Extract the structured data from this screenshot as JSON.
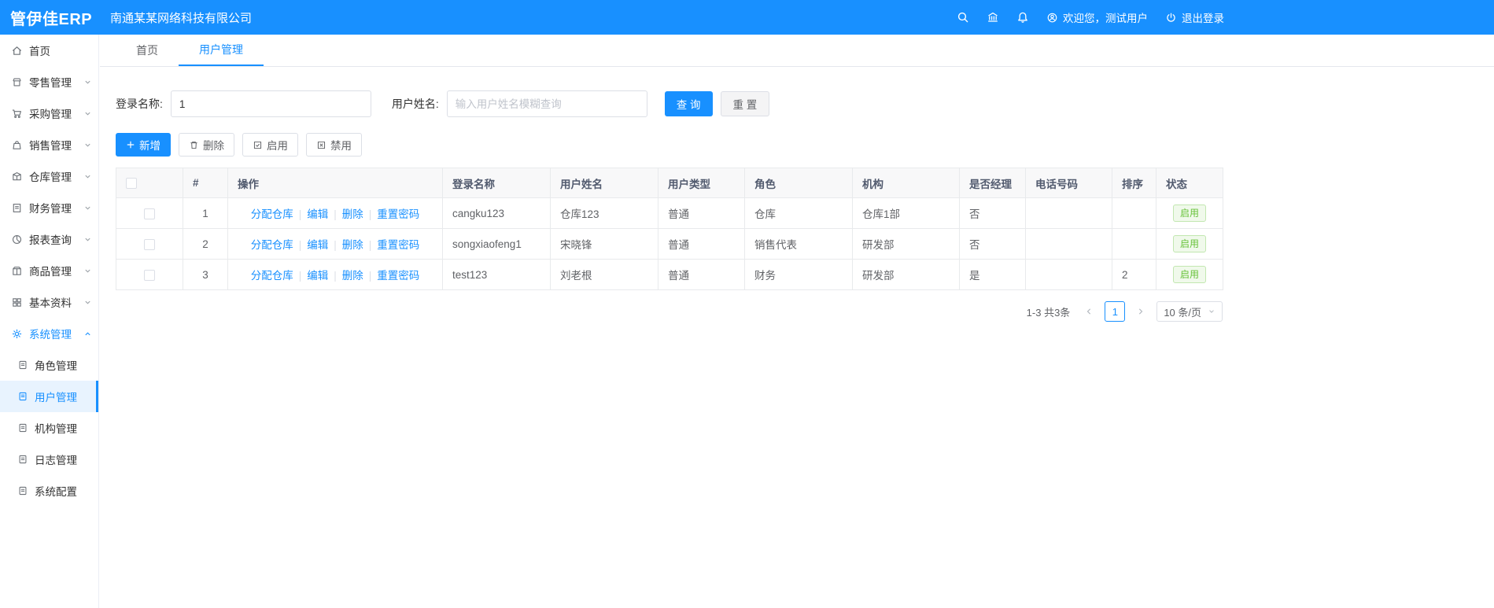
{
  "header": {
    "logo": "管伊佳ERP",
    "company": "南通某某网络科技有限公司",
    "welcome": "欢迎您，测试用户",
    "logout": "退出登录"
  },
  "sidebar": {
    "items": [
      {
        "label": "首页"
      },
      {
        "label": "零售管理"
      },
      {
        "label": "采购管理"
      },
      {
        "label": "销售管理"
      },
      {
        "label": "仓库管理"
      },
      {
        "label": "财务管理"
      },
      {
        "label": "报表查询"
      },
      {
        "label": "商品管理"
      },
      {
        "label": "基本资料"
      },
      {
        "label": "系统管理"
      }
    ],
    "subitems": [
      {
        "label": "角色管理"
      },
      {
        "label": "用户管理"
      },
      {
        "label": "机构管理"
      },
      {
        "label": "日志管理"
      },
      {
        "label": "系统配置"
      }
    ]
  },
  "tabs": [
    {
      "label": "首页"
    },
    {
      "label": "用户管理"
    }
  ],
  "filter": {
    "login_label": "登录名称:",
    "login_value": "1",
    "name_label": "用户姓名:",
    "name_placeholder": "输入用户姓名模糊查询",
    "search_label": "查 询",
    "reset_label": "重 置"
  },
  "toolbar": {
    "add_label": "新增",
    "delete_label": "删除",
    "enable_label": "启用",
    "disable_label": "禁用"
  },
  "table": {
    "headers": {
      "index": "#",
      "actions": "操作",
      "login": "登录名称",
      "name": "用户姓名",
      "type": "用户类型",
      "role": "角色",
      "org": "机构",
      "manager": "是否经理",
      "phone": "电话号码",
      "sort": "排序",
      "status": "状态"
    },
    "op_links": [
      "分配仓库",
      "编辑",
      "删除",
      "重置密码"
    ],
    "rows": [
      {
        "index": "1",
        "login": "cangku123",
        "name": "仓库123",
        "type": "普通",
        "role": "仓库",
        "org": "仓库1部",
        "manager": "否",
        "phone": "",
        "sort": "",
        "status": "启用"
      },
      {
        "index": "2",
        "login": "songxiaofeng1",
        "name": "宋晓锋",
        "type": "普通",
        "role": "销售代表",
        "org": "研发部",
        "manager": "否",
        "phone": "",
        "sort": "",
        "status": "启用"
      },
      {
        "index": "3",
        "login": "test123",
        "name": "刘老根",
        "type": "普通",
        "role": "财务",
        "org": "研发部",
        "manager": "是",
        "phone": "",
        "sort": "2",
        "status": "启用"
      }
    ]
  },
  "pagination": {
    "summary": "1-3 共3条",
    "current_page": "1",
    "page_size": "10 条/页"
  },
  "colors": {
    "primary": "#1890ff",
    "success": "#67c23a"
  }
}
